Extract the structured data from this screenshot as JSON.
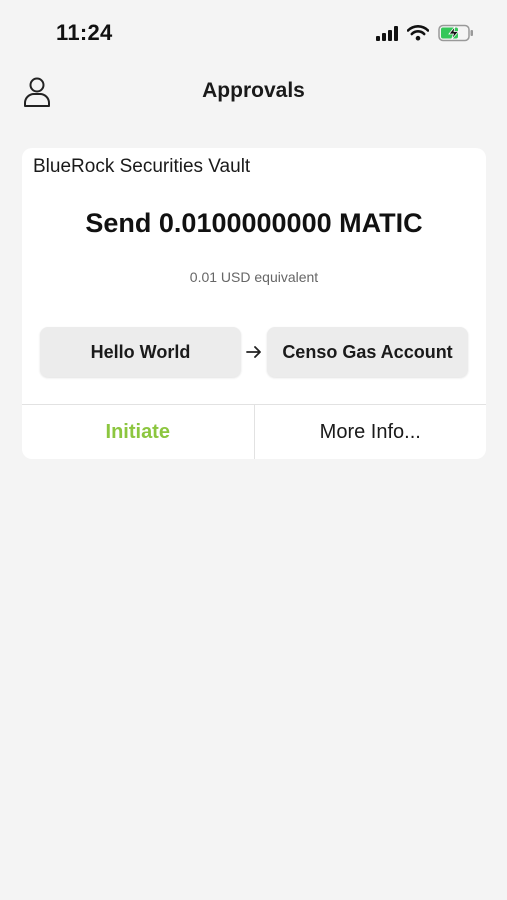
{
  "status_bar": {
    "time": "11:24",
    "icons": [
      "cellular-signal-icon",
      "wifi-icon",
      "battery-charging-icon"
    ],
    "battery_color": "#34c759"
  },
  "header": {
    "title": "Approvals",
    "profile_icon": "person-icon"
  },
  "approval_card": {
    "vault_name": "BlueRock Securities Vault",
    "amount_text": "Send 0.0100000000 MATIC",
    "usd_equivalent": "0.01 USD equivalent",
    "from_account": "Hello World",
    "to_account": "Censo Gas Account",
    "arrow_icon": "arrow-right-icon",
    "initiate_label": "Initiate",
    "more_info_label": "More Info..."
  },
  "colors": {
    "background": "#f4f4f4",
    "card": "#ffffff",
    "accent_green": "#8cc63f",
    "chip": "#ececec"
  }
}
